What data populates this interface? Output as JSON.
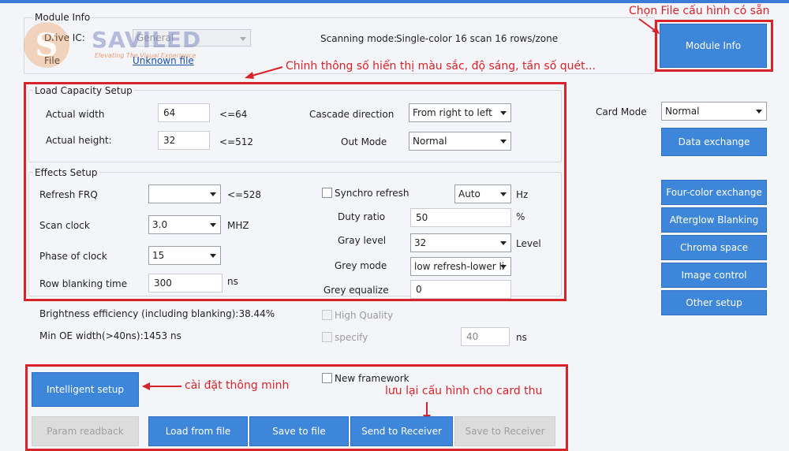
{
  "module_info": {
    "title": "Module Info",
    "drive_ic_label": "Drive IC:",
    "drive_ic_value": "General",
    "file_label": "File",
    "file_link": "Unknown file",
    "scanning_mode_label": "Scanning mode:",
    "scanning_mode_value": "Single-color 16 scan 16 rows/zone",
    "button": "Module Info"
  },
  "logo": {
    "mark": "S",
    "name": "SAVILED",
    "tagline": "Elevating The Visual Experience"
  },
  "annotations": {
    "choose_file": "Chọn File cấu hình có sẵn",
    "adjust_params": "Chỉnh thông số hiển thị màu sắc, độ sáng, tần số quét...",
    "smart_setup": "cài đặt thông minh",
    "save_config": "lưu lại cấu hình cho card thu"
  },
  "load_capacity": {
    "title": "Load Capacity Setup",
    "actual_width_label": "Actual width",
    "actual_width_value": "64",
    "actual_width_limit": "<=64",
    "actual_height_label": "Actual height:",
    "actual_height_value": "32",
    "actual_height_limit": "<=512",
    "cascade_label": "Cascade direction",
    "cascade_value": "From right to left",
    "out_mode_label": "Out Mode",
    "out_mode_value": "Normal"
  },
  "card": {
    "card_mode_label": "Card Mode",
    "card_mode_value": "Normal",
    "data_exchange": "Data exchange"
  },
  "effects": {
    "title": "Effects Setup",
    "refresh_frq_label": "Refresh FRQ",
    "refresh_frq_value": "",
    "refresh_frq_limit": "<=528",
    "scan_clock_label": "Scan clock",
    "scan_clock_value": "3.0",
    "scan_clock_unit": "MHZ",
    "phase_label": "Phase of clock",
    "phase_value": "15",
    "row_blank_label": "Row blanking time",
    "row_blank_value": "300",
    "row_blank_unit": "ns",
    "synchro_label": "Synchro refresh",
    "synchro_value": "Auto",
    "synchro_unit": "Hz",
    "duty_label": "Duty ratio",
    "duty_value": "50",
    "duty_unit": "%",
    "gray_level_label": "Gray level",
    "gray_level_value": "32",
    "gray_level_unit": "Level",
    "grey_mode_label": "Grey mode",
    "grey_mode_value": "low refresh-lower li",
    "grey_eq_label": "Grey equalize",
    "grey_eq_value": "0"
  },
  "side_buttons": {
    "four_color": "Four-color exchange",
    "afterglow": "Afterglow Blanking",
    "chroma": "Chroma space",
    "image_control": "Image control",
    "other_setup": "Other setup"
  },
  "info": {
    "brightness": "Brightness efficiency (including blanking):38.44%",
    "min_oe": "Min OE width(>40ns):1453 ns",
    "high_quality": "High Quality",
    "specify": "specify",
    "specify_value": "40",
    "specify_unit": "ns"
  },
  "bottom": {
    "new_framework": "New framework",
    "intelligent_setup": "Intelligent setup",
    "param_readback": "Param readback",
    "load_from_file": "Load from file",
    "save_to_file": "Save to file",
    "send_to_receiver": "Send to Receiver",
    "save_to_receiver": "Save to Receiver"
  }
}
